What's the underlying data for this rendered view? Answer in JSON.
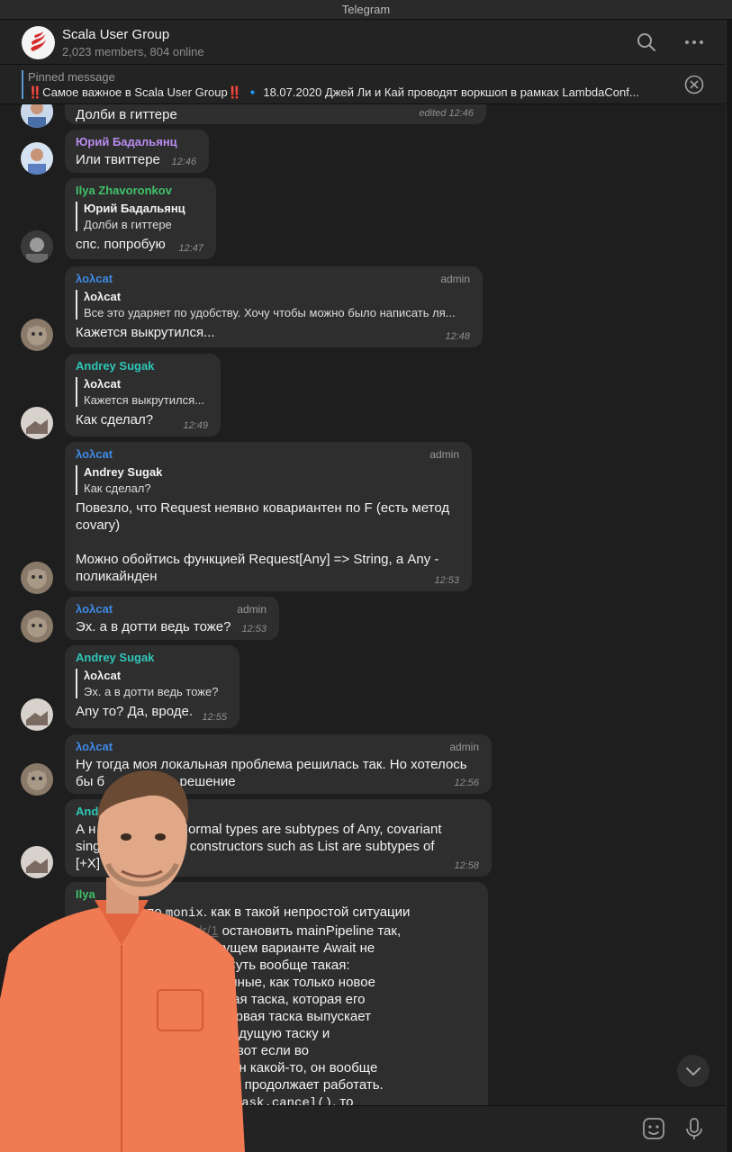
{
  "window": {
    "title": "Telegram"
  },
  "header": {
    "chat_title": "Scala User Group",
    "subtitle": "2,023 members, 804 online",
    "icons": [
      "search-icon",
      "more-icon"
    ]
  },
  "pinned": {
    "label": "Pinned message",
    "text": "‼️Самое важное в Scala User Group‼️  🔹 18.07.2020 Джей Ли и Кай проводят воркшоп в рамках LambdaConf..."
  },
  "messages": [
    {
      "text": "Долби в гиттере",
      "time": "edited  12:46"
    },
    {
      "sender": "Юрий Бадальянц",
      "sender_color": "#b98cf0",
      "text": "Или твиттере",
      "time": "12:46"
    },
    {
      "sender": "Ilya Zhavoronkov",
      "sender_color": "#3fc26a",
      "reply_name": "Юрий Бадальянц",
      "reply_text": "Долби в гиттере",
      "text": "спс. попробую",
      "time": "12:47"
    },
    {
      "sender": "λολcat",
      "sender_color": "#3e8be6",
      "role": "admin",
      "reply_name": "λολcat",
      "reply_text": "Все это ударяет по удобству. Хочу чтобы можно было написать ля...",
      "text": "Кажется выкрутился...",
      "time": "12:48"
    },
    {
      "sender": "Andrey Sugak",
      "sender_color": "#2ec6b8",
      "reply_name": "λολcat",
      "reply_text": "Кажется выкрутился...",
      "text": "Как сделал?",
      "time": "12:49"
    },
    {
      "sender": "λολcat",
      "sender_color": "#3e8be6",
      "role": "admin",
      "reply_name": "Andrey Sugak",
      "reply_text": "Как сделал?",
      "text_line1": "Повезло, что Request неявно ковариантен по F (есть метод",
      "text_line2": "covary)",
      "text_line3": "Можно обойтись функцией Request[Any] => String, а Any -",
      "text_line4": "поликайнден",
      "time": "12:53"
    },
    {
      "sender": "λολcat",
      "sender_color": "#3e8be6",
      "role": "admin",
      "text": "Эх. а в дотти ведь тоже?",
      "time": "12:53"
    },
    {
      "sender": "Andrey Sugak",
      "sender_color": "#2ec6b8",
      "reply_name": "λολcat",
      "reply_text": "Эх. а в дотти ведь тоже?",
      "text": "Any то? Да, вроде.",
      "time": "12:55"
    },
    {
      "sender": "λολcat",
      "sender_color": "#3e8be6",
      "role": "admin",
      "text_line1": "Ну тогда моя локальная проблема решилась так. Но хотелось",
      "text_line2": "бы б                    решение",
      "time": "12:56"
    },
    {
      "sender": "And",
      "sender_color": "#2ec6b8",
      "text_line1": "А н                  е. Normal types are subtypes of Any, covariant",
      "text_line2": "sing                type constructors such as List are subtypes of",
      "text_line3": "[+X]",
      "time": "12:58"
    },
    {
      "sender": "Ilya",
      "sender_color": "#3fc26a",
      "lines": [
        "                   по ",
        "                 ",
        "                  ботал? В текущем варианте Await не",
        "                      сит вечно. Суть вообще такая:",
        "                   я какие-то данные, как только новое",
        "                     скается другая таска, которая его",
        "                      ьно с ней первая таска выпускает",
        "                    меняет предыдущую таску и",
        "                    значением. и вот если во",
        "                   ходит эксепшен какой-то, он вообще",
        "                     ной пайплайн продолжает работать.",
        "                  "
      ],
      "mono1": "monix",
      "after_mono1": ". как в такой непростой ситуации",
      "link": "/hgpm4dr/1",
      "link_prefix": "sf",
      "after_link": " остановить mainPipeline так,",
      "mono2": "nnerPipelineTask.cancel()",
      "after_mono2": ", то"
    }
  ],
  "composer": {
    "icons": [
      "attach-icon",
      "sticker-icon",
      "microphone-icon"
    ]
  },
  "overlay": {
    "description_icon": "person-photo"
  }
}
